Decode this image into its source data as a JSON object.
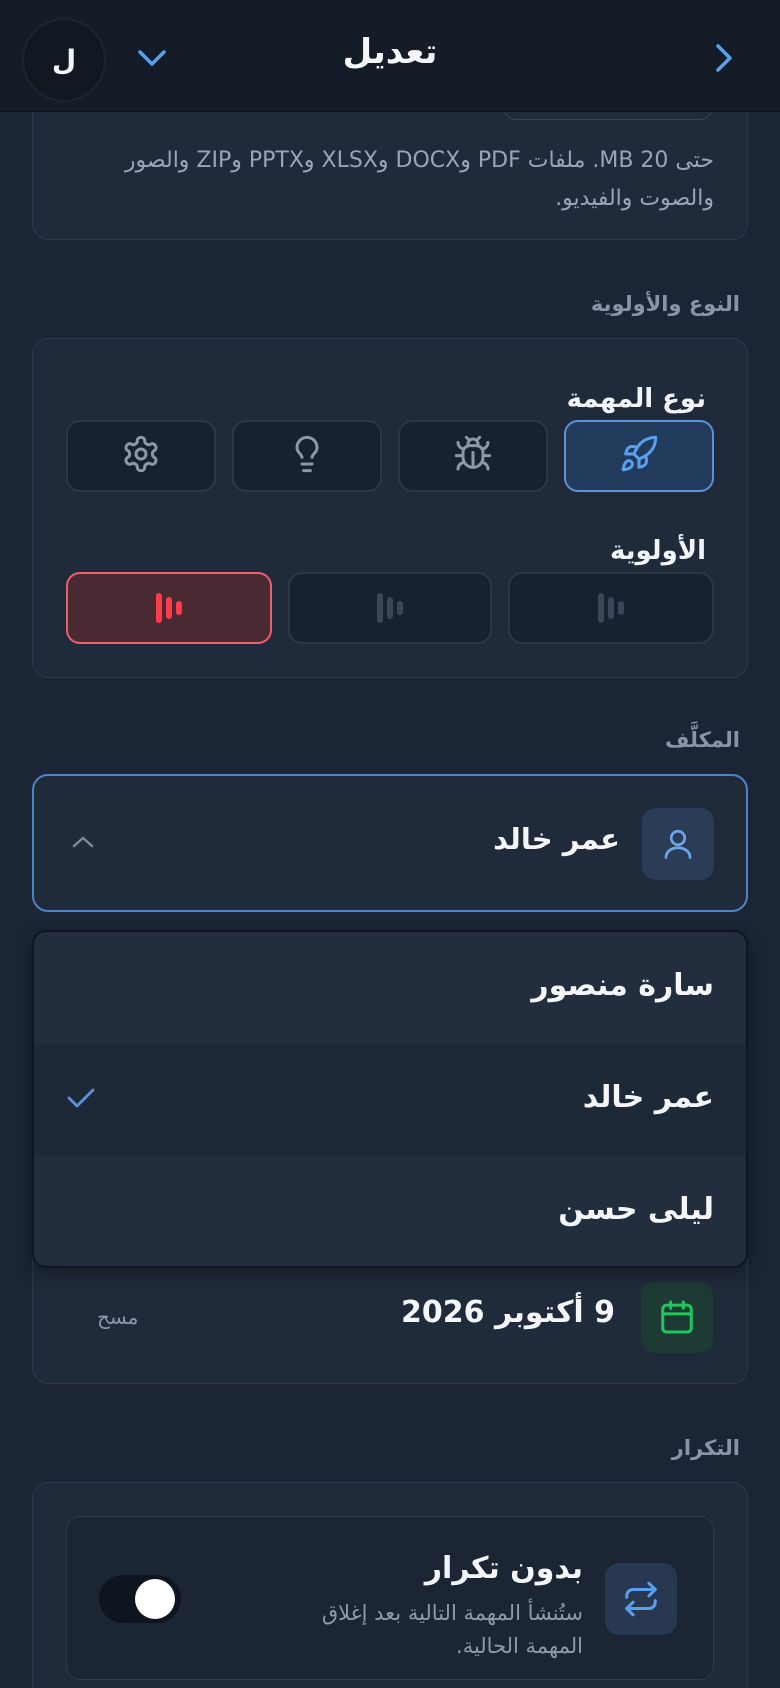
{
  "header": {
    "title": "تعديل",
    "avatar_initial": "ل"
  },
  "attachments": {
    "note": "حتى 20 MB. ملفات PDF وDOCX وXLSX وPPTX وZIP والصور والصوت والفيديو."
  },
  "type_priority": {
    "section_label": "النوع والأولوية",
    "task_type_label": "نوع المهمة",
    "task_types": [
      {
        "icon": "rocket-icon",
        "selected": true
      },
      {
        "icon": "bug-icon",
        "selected": false
      },
      {
        "icon": "lightbulb-icon",
        "selected": false
      },
      {
        "icon": "gear-icon",
        "selected": false
      }
    ],
    "priority_label": "الأولوية",
    "priorities": [
      {
        "level": "low",
        "selected": false
      },
      {
        "level": "medium",
        "selected": false
      },
      {
        "level": "high",
        "selected": true,
        "color": "#ff3b4a"
      }
    ]
  },
  "assignee": {
    "section_label": "المكلَّف",
    "selected": "عمر خالد",
    "options": [
      "سارة منصور",
      "عمر خالد",
      "ليلى حسن"
    ]
  },
  "due_date": {
    "value": "9 أكتوبر 2026",
    "clear_label": "مسح"
  },
  "recurrence": {
    "section_label": "التكرار",
    "title": "بدون تكرار",
    "description": "ستُنشأ المهمة التالية بعد إغلاق المهمة الحالية.",
    "toggle_on": false
  },
  "colors": {
    "accent": "#5b92d8",
    "danger": "#ff3b4a",
    "success": "#22c55e",
    "background": "#1b2535"
  }
}
